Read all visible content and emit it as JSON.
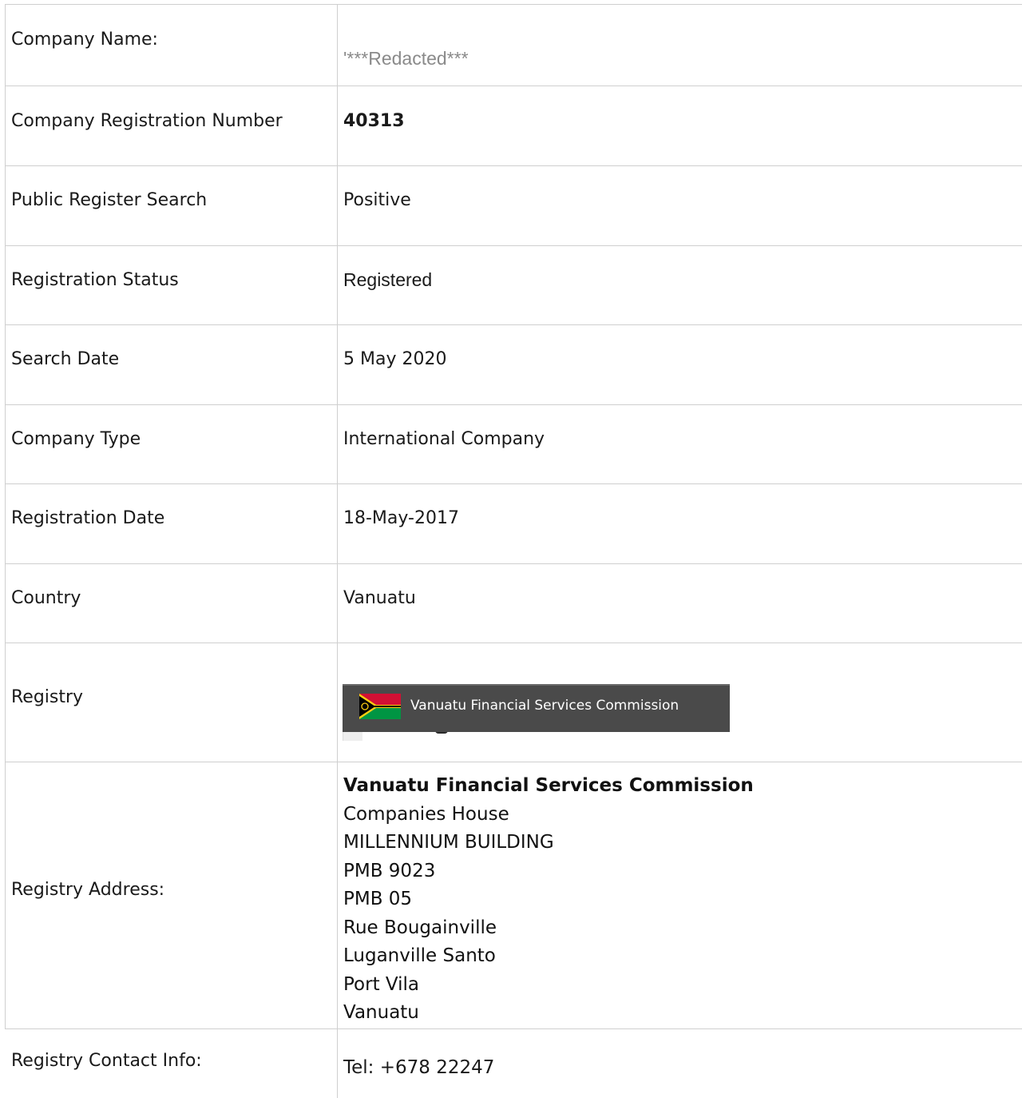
{
  "rows": [
    {
      "label": "Company Name:",
      "value": "'***Redacted***"
    },
    {
      "label": "Company Registration Number",
      "value": "40313"
    },
    {
      "label": "Public Register Search",
      "value": "Positive"
    },
    {
      "label": "Registration Status",
      "value": "Registered"
    },
    {
      "label": "Search Date",
      "value": "5 May 2020"
    },
    {
      "label": "Company Type",
      "value": "International Company"
    },
    {
      "label": "Registration Date",
      "value": "18-May-2017"
    },
    {
      "label": "Country",
      "value": "Vanuatu"
    },
    {
      "label": "Registry",
      "value": ""
    },
    {
      "label": "Registry Address:",
      "value": ""
    },
    {
      "label": "Registry Contact Info:",
      "value": "Tel: +678 22247"
    }
  ],
  "registry_banner": {
    "text": "Vanuatu Financial Services Commission",
    "flag_icon": "vanuatu-flag-icon"
  },
  "registry_address": {
    "name": "Vanuatu Financial Services Commission",
    "lines": [
      "Companies House",
      "MILLENNIUM BUILDING",
      "PMB 9023",
      "PMB 05",
      "Rue Bougainville",
      "Luganville Santo",
      "Port Vila",
      "Vanuatu"
    ]
  },
  "colors": {
    "border": "#cfcfcf",
    "banner_bg": "#4a4a4a",
    "redacted_text": "#8a8a8a",
    "flag_red": "#d21034",
    "flag_green": "#009543",
    "flag_black": "#000000",
    "flag_yellow": "#fdce12"
  }
}
